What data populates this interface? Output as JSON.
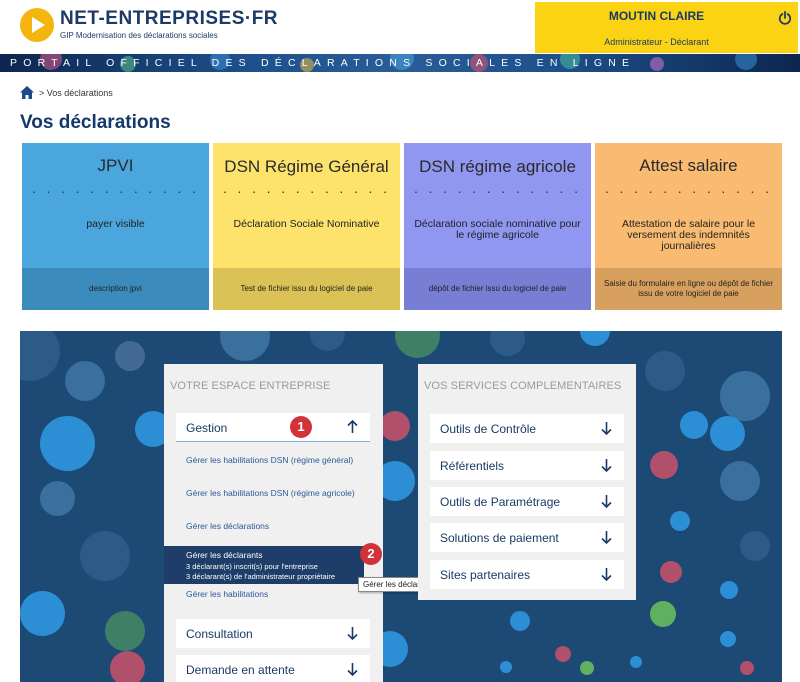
{
  "header": {
    "logo_name": "NET-ENTREPRISES·FR",
    "logo_sub": "GIP Modernisation des déclarations sociales",
    "user_name": "MOUTIN CLAIRE",
    "user_role": "Administrateur - Déclarant",
    "banner": "PORTAIL OFFICIEL DES DÉCLARATIONS SOCIALES EN LIGNE"
  },
  "breadcrumb": "> Vos déclarations",
  "page_title": "Vos déclarations",
  "cards": [
    {
      "title": "JPVI",
      "dots": "· · · · · · · · · · · ·",
      "description": "payer visible",
      "footer": "description jpvi",
      "color": "#4aa6dc",
      "foot_color": "#3b8cbd"
    },
    {
      "title": "DSN Régime Général",
      "dots": "· · · · · · · · · · · ·",
      "description": "Déclaration Sociale Nominative",
      "footer": "Test de fichier issu du logiciel de paie",
      "color": "#fde36b",
      "foot_color": "#dbc257"
    },
    {
      "title": "DSN régime agricole",
      "dots": "· · · · · · · · · · · ·",
      "description": "Déclaration sociale nominative pour le régime agricole",
      "footer": "dépôt de fichier issu du logiciel de paie",
      "color": "#9097f0",
      "foot_color": "#777ed3"
    },
    {
      "title": "Attest salaire",
      "dots": "· · · · · · · · · · · ·",
      "description": "Attestation de salaire pour le versement des indemnités journalières",
      "footer": "Saisie du formulaire en ligne ou dépôt de fichier issu de votre logiciel de paie",
      "color": "#f8bb71",
      "foot_color": "#d7a05f"
    }
  ],
  "espace": {
    "title": "VOTRE ESPACE ENTREPRISE",
    "gestion_label": "Gestion",
    "sublinks": [
      "Gérer les habilitations DSN (régime général)",
      "Gérer les habilitations DSN (régime agricole)",
      "Gérer les déclarations"
    ],
    "active_link": "Gérer les déclarants",
    "active_line1": "3 déclarant(s) inscrit(s) pour l'entreprise",
    "active_line2": "3 déclarant(s) de l'administrateur propriétaire",
    "habilitations_link": "Gérer les habilitations",
    "consultation_label": "Consultation",
    "attente_label": "Demande en attente",
    "tooltip": "Gérer les déclarants",
    "badge1": "1",
    "badge2": "2"
  },
  "services": {
    "title": "VOS SERVICES COMPLEMENTAIRES",
    "items": [
      "Outils de Contrôle",
      "Référentiels",
      "Outils de Paramétrage",
      "Solutions de paiement",
      "Sites partenaires"
    ]
  },
  "colors": {
    "navy": "#1d4a74",
    "accent_yellow": "#fbd313",
    "badge_red": "#d2323a",
    "title_blue": "#16396b"
  }
}
